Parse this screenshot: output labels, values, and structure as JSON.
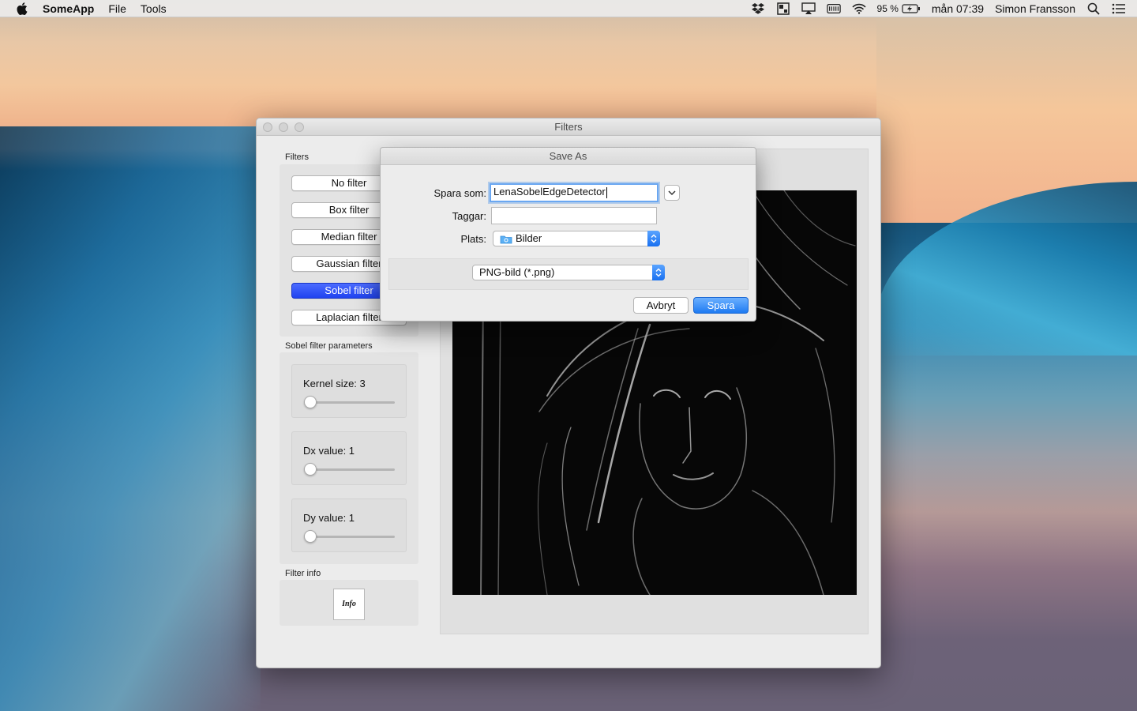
{
  "menubar": {
    "app_name": "SomeApp",
    "menus": [
      "File",
      "Tools"
    ],
    "battery": "95 %",
    "clock": "mån 07:39",
    "user": "Simon Fransson",
    "icons": [
      "dropbox-icon",
      "window-manager-icon",
      "airplay-icon",
      "keyboard-icon",
      "wifi-icon",
      "battery-icon",
      "search-icon",
      "notification-list-icon"
    ]
  },
  "window": {
    "title": "Filters",
    "filters_label": "Filters",
    "filter_buttons": [
      "No filter",
      "Box filter",
      "Median filter",
      "Gaussian filter",
      "Sobel filter",
      "Laplacian filter"
    ],
    "selected_filter": "Sobel filter",
    "params_label": "Sobel filter parameters",
    "params": [
      {
        "label": "Kernel size: 3",
        "slider_value": 0
      },
      {
        "label": "Dx value: 1",
        "slider_value": 0
      },
      {
        "label": "Dy value: 1",
        "slider_value": 0
      }
    ],
    "info_label": "Filter info",
    "info_button": "Info"
  },
  "dialog": {
    "title": "Save As",
    "save_as_label": "Spara som:",
    "save_as_value": "LenaSobelEdgeDetector",
    "tags_label": "Taggar:",
    "tags_value": "",
    "location_label": "Plats:",
    "location_value": "Bilder",
    "format_value": "PNG-bild (*.png)",
    "cancel_label": "Avbryt",
    "save_label": "Spara"
  },
  "colors": {
    "accent": "#2f7ff5",
    "selected_filter": "#2b4cf6"
  }
}
